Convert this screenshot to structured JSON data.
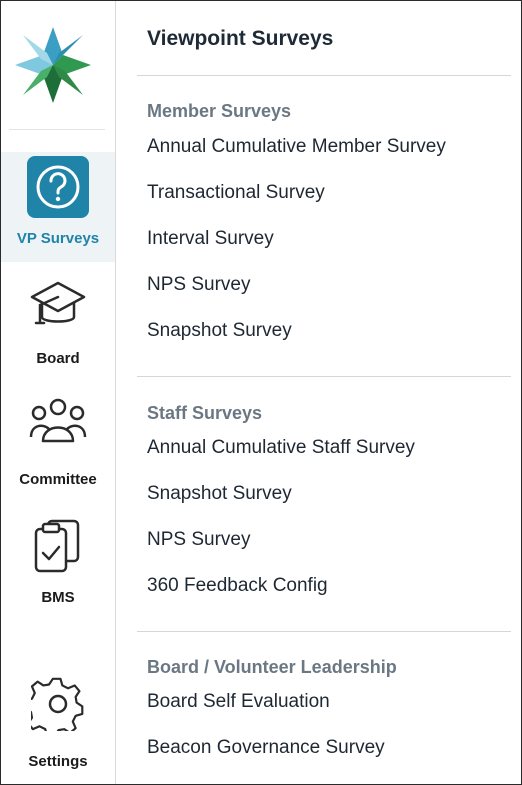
{
  "sidebar": {
    "items": [
      {
        "label": "VP Surveys",
        "icon": "question-circle-icon",
        "active": true
      },
      {
        "label": "Board",
        "icon": "graduation-cap-icon"
      },
      {
        "label": "Committee",
        "icon": "group-icon"
      },
      {
        "label": "BMS",
        "icon": "clipboard-check-icon"
      },
      {
        "label": "Settings",
        "icon": "gear-icon"
      }
    ]
  },
  "main": {
    "title": "Viewpoint Surveys",
    "sections": [
      {
        "title": "Member Surveys",
        "items": [
          "Annual Cumulative Member Survey",
          "Transactional Survey",
          "Interval Survey",
          "NPS Survey",
          "Snapshot Survey"
        ]
      },
      {
        "title": "Staff Surveys",
        "items": [
          "Annual Cumulative Staff Survey",
          "Snapshot Survey",
          "NPS Survey",
          "360 Feedback Config"
        ]
      },
      {
        "title": "Board / Volunteer Leadership",
        "items": [
          "Board Self Evaluation",
          "Beacon Governance Survey"
        ]
      }
    ]
  },
  "colors": {
    "accent": "#1f84a8",
    "logo_light_blue": "#7fc9e0",
    "logo_dark_blue": "#2b8fb0",
    "logo_green": "#2f9a4f",
    "logo_dark_green": "#1e6e3a"
  }
}
